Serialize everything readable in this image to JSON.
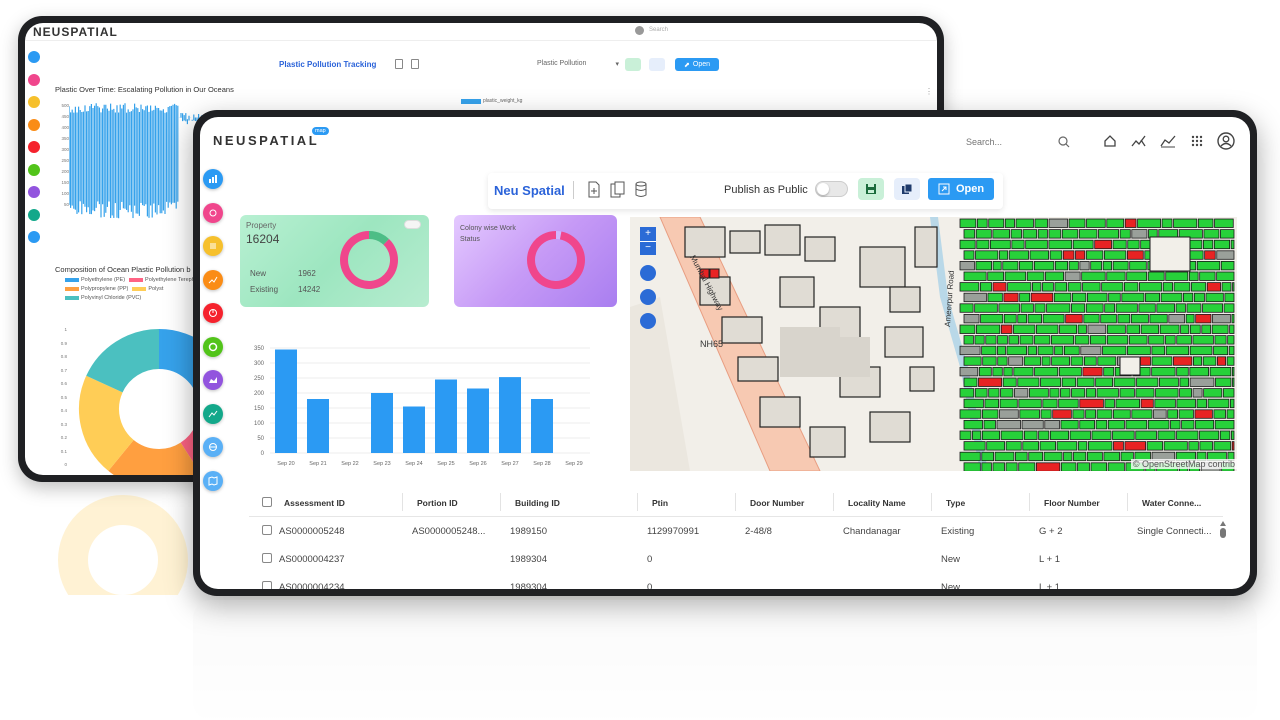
{
  "back": {
    "logo": "NEUSPATIAL",
    "search_placeholder": "Search",
    "title": "Plastic Pollution Tracking",
    "dropdown_value": "Plastic Pollution",
    "open_label": "Open",
    "chart1_title": "Plastic Over Time: Escalating Pollution in Our Oceans",
    "chart1_legend": "plastic_weight_kg",
    "chart1_yticks": [
      "500",
      "450",
      "400",
      "350",
      "300",
      "250",
      "200",
      "150",
      "100",
      "50"
    ],
    "chart2_title": "Composition of Ocean Plastic Pollution b",
    "chart2_legend": [
      "Polyethylene (PE)",
      "Polyethylene Terephthalate (PE",
      "Polypropylene (PP)",
      "Polyst",
      "Polyvinyl Chloride (PVC)"
    ],
    "chart2_yticks": [
      "1",
      "0.9",
      "0.8",
      "0.7",
      "0.6",
      "0.5",
      "0.4",
      "0.3",
      "0.2",
      "0.1",
      "0"
    ],
    "chart2_colors": [
      "#36a2eb",
      "#ff6384",
      "#ff9f40",
      "#ffcd56",
      "#4bc0c0"
    ]
  },
  "front": {
    "logo": "NEUSPATIAL",
    "logo_badge": "map",
    "search_placeholder": "Search...",
    "title": "Neu Spatial",
    "publish_label": "Publish as Public",
    "open_label": "Open",
    "property_card": {
      "label": "Property",
      "value": "16204",
      "rows": [
        {
          "label": "New",
          "value": "1962"
        },
        {
          "label": "Existing",
          "value": "14242"
        }
      ]
    },
    "colony_card": {
      "label": "Colony wise Work Status"
    },
    "map_attribution": "© OpenStreetMap contrib",
    "map_labels": [
      "Mumbai Highway",
      "NH65",
      "Ameerpur Road"
    ],
    "table": {
      "columns": [
        "Assessment ID",
        "Portion ID",
        "Building ID",
        "Ptin",
        "Door Number",
        "Locality Name",
        "Type",
        "Floor Number",
        "Water Conne..."
      ],
      "rows": [
        [
          "AS0000005248",
          "AS0000005248...",
          "1989150",
          "1129970991",
          "2-48/8",
          "Chandanagar",
          "Existing",
          "G + 2",
          "Single Connecti..."
        ],
        [
          "AS0000004237",
          "",
          "1989304",
          "0",
          "",
          "",
          "New",
          "L + 1",
          ""
        ],
        [
          "AS0000004234",
          "",
          "1989304",
          "0",
          "",
          "",
          "New",
          "L + 1",
          ""
        ]
      ]
    }
  },
  "chart_data": [
    {
      "type": "bar",
      "categories": [
        "Sep 20",
        "Sep 21",
        "Sep 22",
        "Sep 23",
        "Sep 24",
        "Sep 25",
        "Sep 26",
        "Sep 27",
        "Sep 28",
        "Sep 29"
      ],
      "values": [
        345,
        180,
        0,
        200,
        155,
        245,
        215,
        253,
        180,
        0
      ],
      "ylim": [
        0,
        350
      ],
      "yticks": [
        "350",
        "300",
        "250",
        "200",
        "150",
        "100",
        "50",
        "0"
      ],
      "color": "#2b9af3",
      "grid": true
    },
    {
      "type": "pie",
      "labels": [
        "New",
        "Existing"
      ],
      "values": [
        1962,
        14242
      ],
      "colors": [
        "#4dbd86",
        "#f0468c"
      ]
    },
    {
      "type": "pie",
      "values": [
        3,
        97
      ],
      "colors": [
        "#d0b6ff",
        "#f0468c"
      ]
    }
  ]
}
